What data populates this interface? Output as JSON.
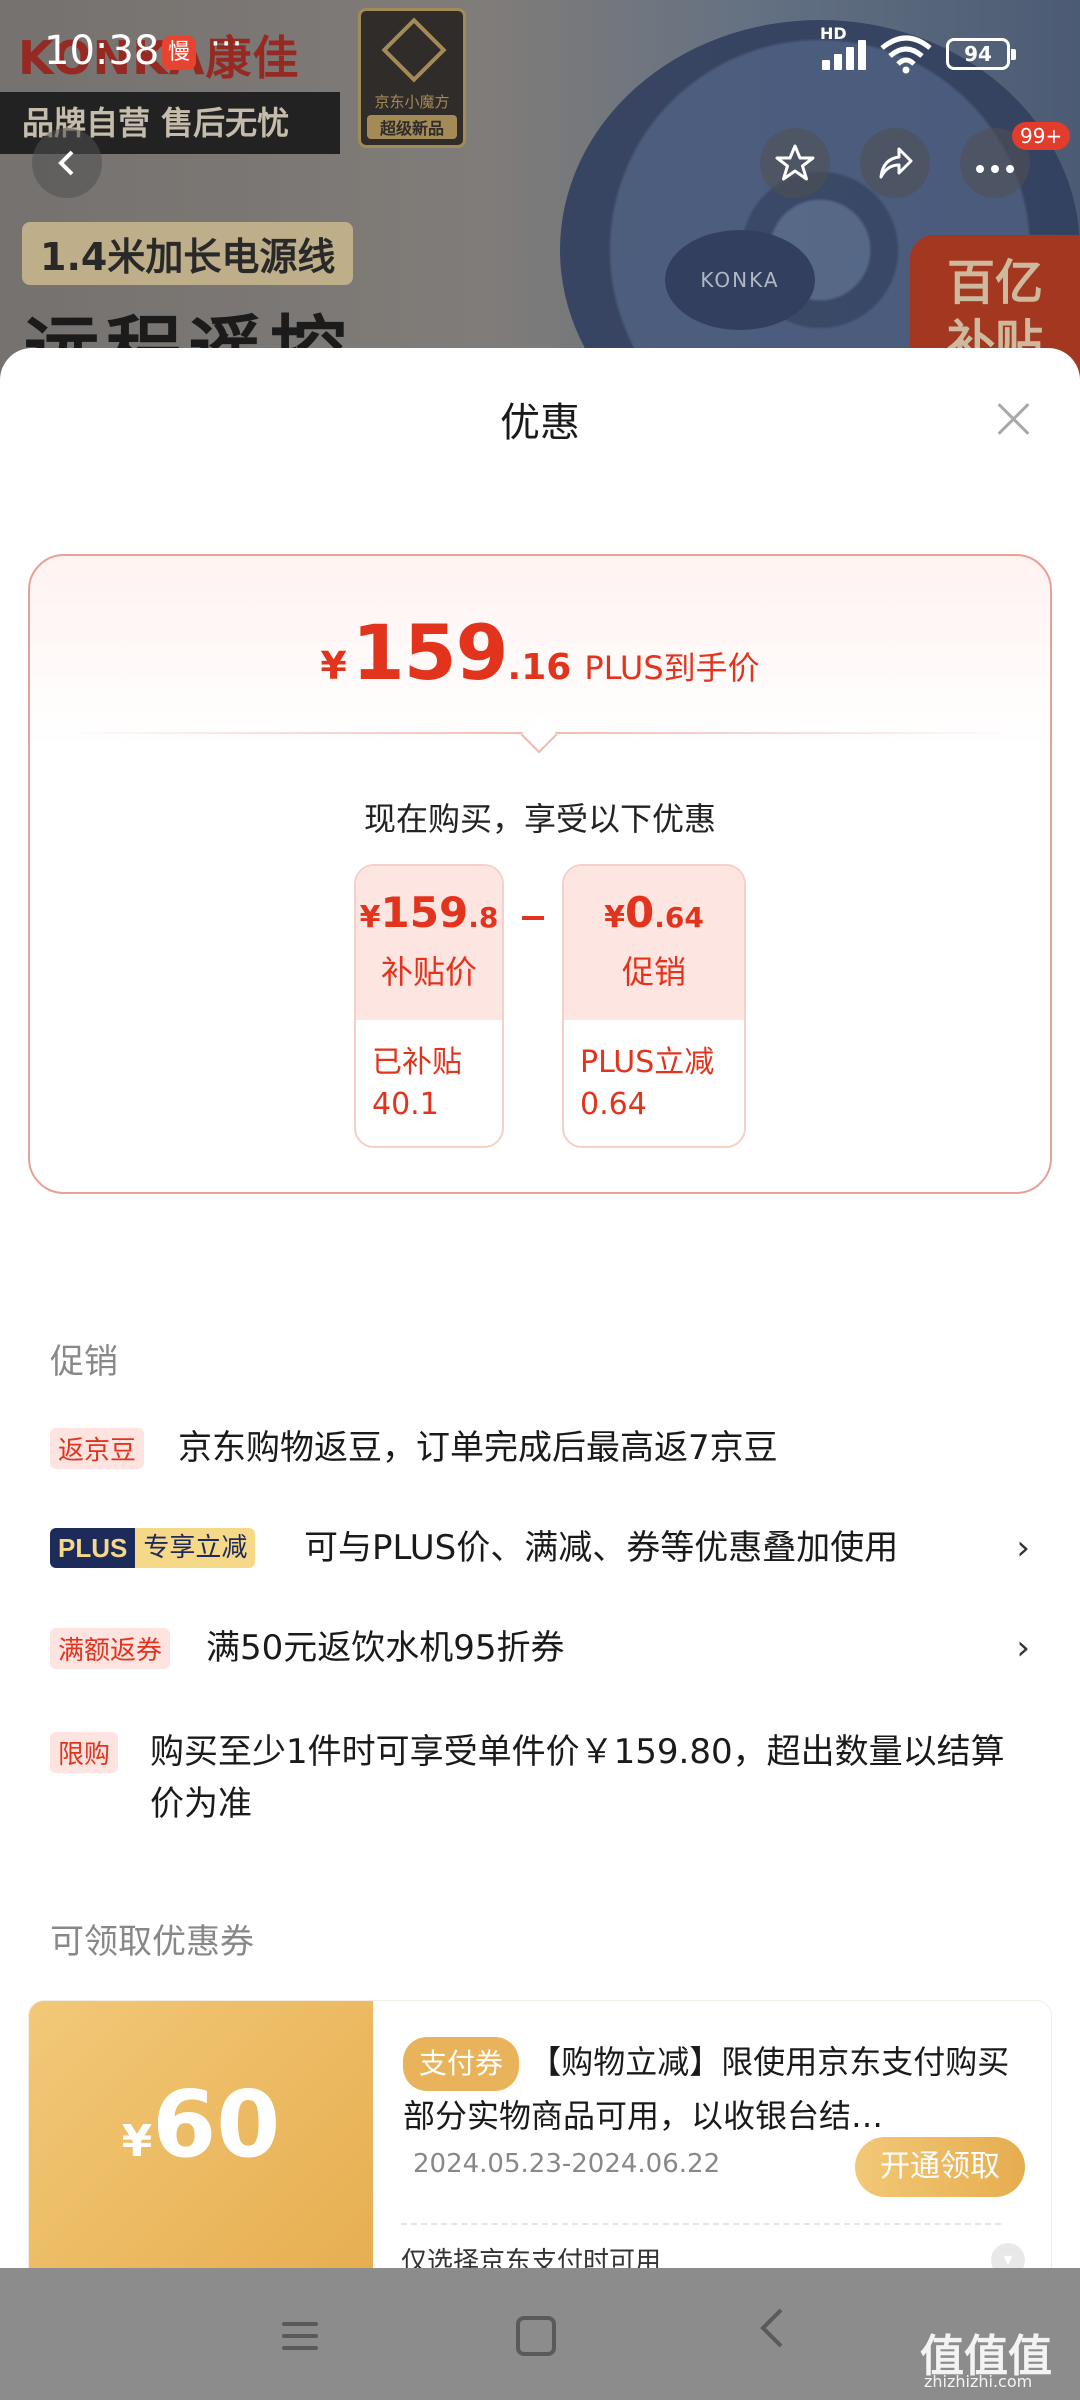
{
  "status_bar": {
    "time": "10:38",
    "notif_glyph": "慢",
    "more": "···",
    "network": "HD",
    "battery": "94"
  },
  "banner": {
    "brand_logo": "KONKA康佳",
    "brand_strip": "品牌自营 售后无忧",
    "jd_badge_name": "京东小魔方",
    "jd_badge_label": "超级新品",
    "length_tag": "1.4米加长电源线",
    "headline": "远程遥控",
    "fan_brand": "KONKA",
    "subsidy_badge": "百亿\n补贴",
    "cart_count": "99+"
  },
  "sheet": {
    "title": "优惠",
    "price": {
      "currency": "¥",
      "int": "159",
      "dec": ".16",
      "label": "PLUS到手价"
    },
    "buy_now": "现在购买，享受以下优惠",
    "deals": [
      {
        "currency": "¥",
        "int": "159",
        "dec": ".8",
        "label": "补贴价",
        "note": "已补贴\n40.1"
      },
      {
        "currency": "¥",
        "int": "0",
        "dec": ".64",
        "label": "促销",
        "note": "PLUS立减\n0.64"
      }
    ],
    "promo_section": "促销",
    "promos": [
      {
        "tag": "返京豆",
        "text": "京东购物返豆，订单完成后最高返7京豆"
      },
      {
        "tag_a": "PLUS",
        "tag_b": "专享立减",
        "text": "可与PLUS价、满减、券等优惠叠加使用",
        "arrow": "›"
      },
      {
        "tag": "满额返券",
        "text": "满50元返饮水机95折券",
        "arrow": "›"
      },
      {
        "tag": "限购",
        "text": "购买至少1件时可享受单件价￥159.80，超出数量以结算价为准"
      }
    ],
    "coupon_section": "可领取优惠券",
    "coupon": {
      "currency": "¥",
      "amount": "60",
      "tag": "支付券",
      "desc": "【购物立减】限使用京东支付购买部分实物商品可用，以收银台结…",
      "date": "2024.05.23-2024.06.22",
      "button": "开通领取",
      "note": "仅选择京东支付时可用"
    }
  },
  "watermark": {
    "main": "值值值",
    "sub": "zhizhizhi.com"
  },
  "colors": {
    "accent_red": "#e2341d",
    "gold": "#e6ad4f",
    "plus_navy": "#1c2b5a"
  }
}
